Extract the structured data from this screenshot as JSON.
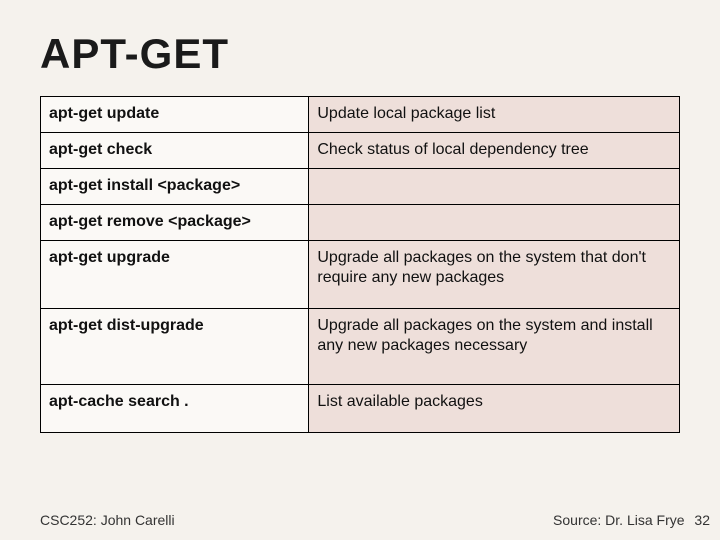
{
  "title": "APT-GET",
  "rows": [
    {
      "cmd": "apt-get update",
      "desc": "Update local package list"
    },
    {
      "cmd": "apt-get check",
      "desc": "Check status of local dependency tree"
    },
    {
      "cmd": "apt-get install <package>",
      "desc": ""
    },
    {
      "cmd": "apt-get remove <package>",
      "desc": ""
    },
    {
      "cmd": "apt-get upgrade",
      "desc": "Upgrade all packages on the system that don't require any new packages"
    },
    {
      "cmd": "apt-get dist-upgrade",
      "desc": "Upgrade all packages on the system and install any new packages necessary"
    },
    {
      "cmd": "apt-cache search .",
      "desc": "List available packages"
    }
  ],
  "footer": {
    "left": "CSC252: John Carelli",
    "right": "Source: Dr. Lisa Frye",
    "page": "32"
  }
}
